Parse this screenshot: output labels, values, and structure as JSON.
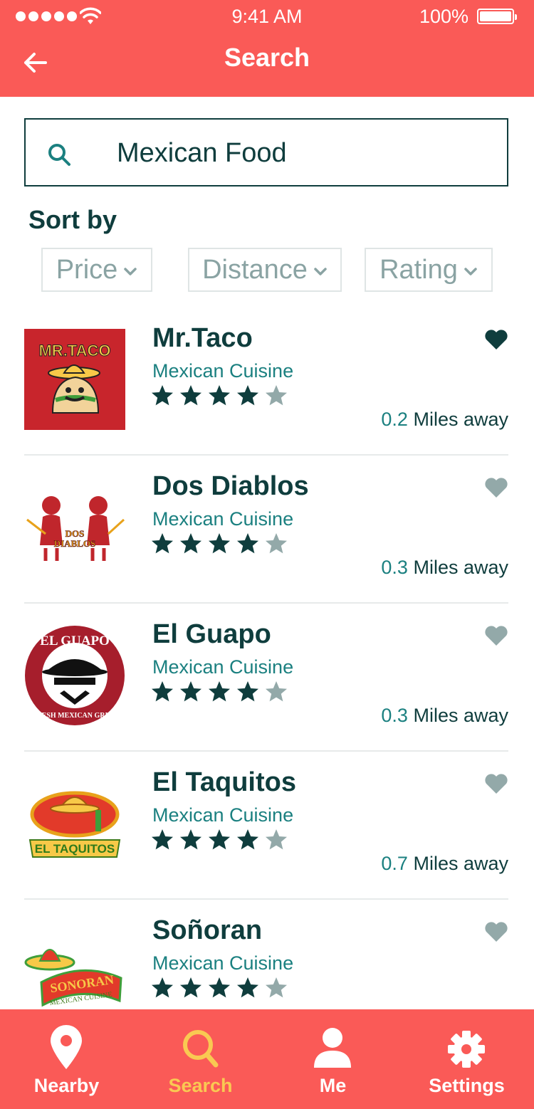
{
  "status_bar": {
    "time": "9:41 AM",
    "battery": "100%"
  },
  "header": {
    "title": "Search"
  },
  "search": {
    "value": "Mexican Food"
  },
  "sort": {
    "label": "Sort by",
    "options": [
      "Price",
      "Distance",
      "Rating"
    ]
  },
  "colors": {
    "accent": "#fa5a57",
    "dark": "#0f3d3d",
    "teal": "#1b8080",
    "active_tab": "#f9c952",
    "muted": "#8aa3a3"
  },
  "restaurants": [
    {
      "name": "Mr.Taco",
      "cuisine": "Mexican Cuisine",
      "rating": 4,
      "max_rating": 5,
      "distance_value": "0.2",
      "distance_unit": "Miles away",
      "favorited": true,
      "logo_text": "MR.TACO"
    },
    {
      "name": "Dos Diablos",
      "cuisine": "Mexican Cuisine",
      "rating": 4,
      "max_rating": 5,
      "distance_value": "0.3",
      "distance_unit": "Miles away",
      "favorited": false,
      "logo_text": "DOS DIABLOS"
    },
    {
      "name": "El Guapo",
      "cuisine": "Mexican Cuisine",
      "rating": 4,
      "max_rating": 5,
      "distance_value": "0.3",
      "distance_unit": "Miles away",
      "favorited": false,
      "logo_text": "EL GUAPO"
    },
    {
      "name": "El Taquitos",
      "cuisine": "Mexican Cuisine",
      "rating": 4,
      "max_rating": 5,
      "distance_value": "0.7",
      "distance_unit": "Miles away",
      "favorited": false,
      "logo_text": "EL TAQUITOS"
    },
    {
      "name": "Soñoran",
      "cuisine": "Mexican Cuisine",
      "rating": 4,
      "max_rating": 5,
      "favorited": false,
      "logo_text": "SONORAN"
    }
  ],
  "tabs": [
    {
      "label": "Nearby",
      "icon": "location-pin-icon",
      "active": false
    },
    {
      "label": "Search",
      "icon": "search-icon",
      "active": true
    },
    {
      "label": "Me",
      "icon": "person-icon",
      "active": false
    },
    {
      "label": "Settings",
      "icon": "gear-icon",
      "active": false
    }
  ]
}
